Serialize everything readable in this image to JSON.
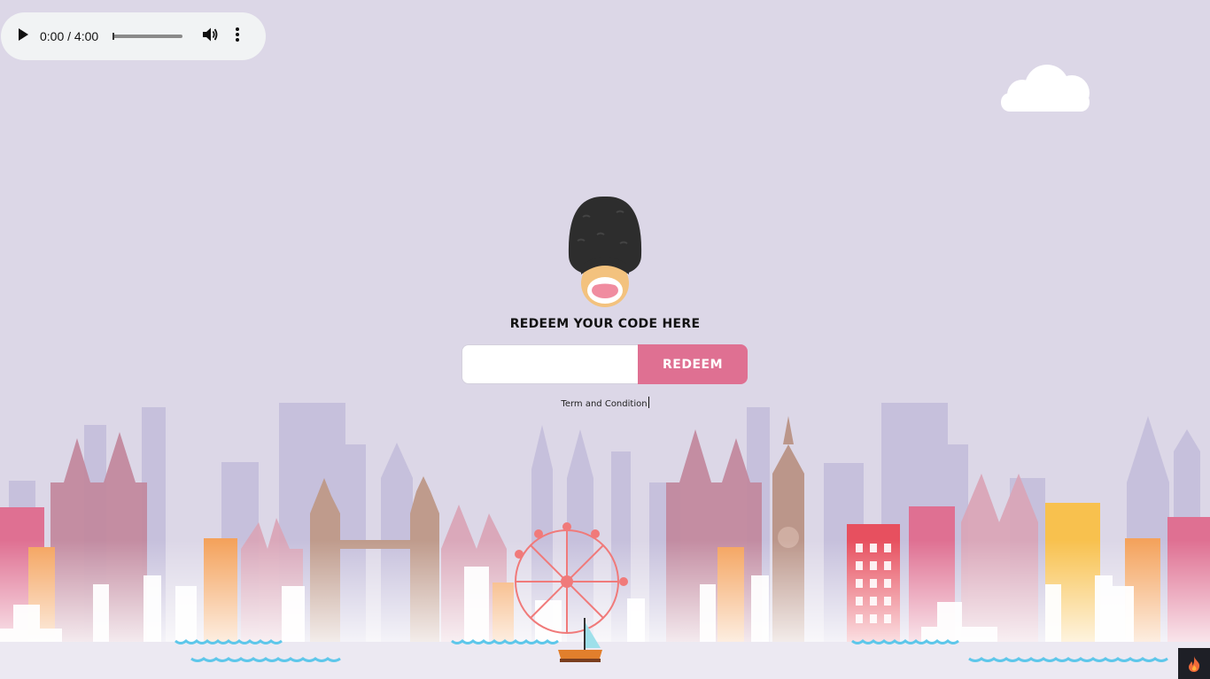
{
  "audio_player": {
    "time_display": "0:00 / 4:00",
    "play_icon": "play-icon",
    "volume_icon": "volume-icon",
    "menu_icon": "more-vertical-icon"
  },
  "redeem": {
    "title": "REDEEM YOUR CODE HERE",
    "input_value": "",
    "input_placeholder": "",
    "button_label": "REDEEM"
  },
  "terms_link": "Term and Condition",
  "colors": {
    "background": "#dcd7e7",
    "accent": "#df7092",
    "button_text": "#ffffff",
    "water": "#5ec7ea"
  },
  "illustrations": {
    "mascot": "queens-guard-mascot",
    "skyline": "london-skyline-illustration",
    "cloud": "cloud-icon",
    "badge": "flame-icon"
  }
}
